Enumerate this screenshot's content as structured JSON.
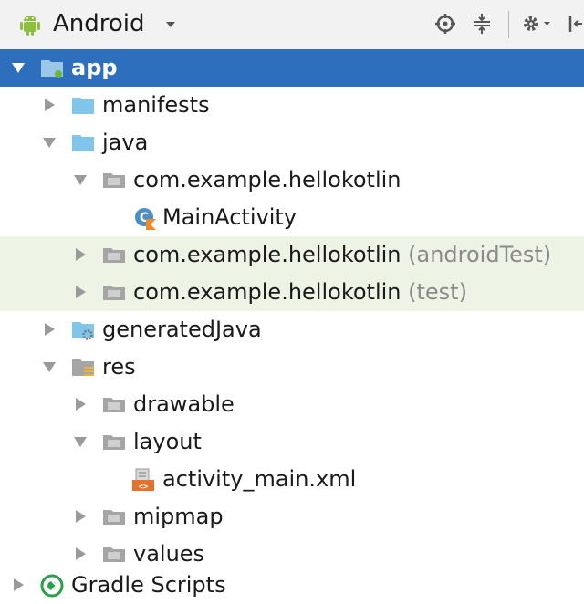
{
  "toolbar": {
    "view_label": "Android",
    "icons": [
      "android-icon",
      "chevron-down-icon",
      "crosshair-icon",
      "collapse-all-icon",
      "gear-icon",
      "hide-icon"
    ]
  },
  "colors": {
    "selection": "#2e6fbd",
    "test_highlight": "#edf4e6",
    "folder_blue": "#7fc6ea",
    "package_gray": "#9a9a9a",
    "kotlin_orange": "#f08a24"
  },
  "tree": {
    "app": "app",
    "manifests": "manifests",
    "java": "java",
    "pkg_main": "com.example.hellokotlin",
    "main_activity": "MainActivity",
    "pkg_android_test": "com.example.hellokotlin",
    "pkg_android_test_suffix": "(androidTest)",
    "pkg_test": "com.example.hellokotlin",
    "pkg_test_suffix": "(test)",
    "generated_java": "generatedJava",
    "res": "res",
    "drawable": "drawable",
    "layout": "layout",
    "activity_main": "activity_main.xml",
    "mipmap": "mipmap",
    "values": "values",
    "gradle_scripts": "Gradle Scripts"
  }
}
